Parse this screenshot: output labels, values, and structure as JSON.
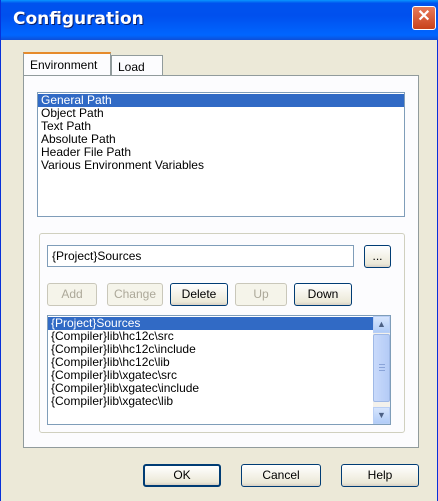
{
  "window": {
    "title": "Configuration",
    "close_glyph": "✕"
  },
  "tabs": [
    {
      "label": "Environment"
    },
    {
      "label": "Load"
    }
  ],
  "env_list": [
    "General Path",
    "Object Path",
    "Text Path",
    "Absolute Path",
    "Header File Path",
    "Various Environment Variables"
  ],
  "path_field": {
    "value": "{Project}Sources"
  },
  "browse_label": "...",
  "path_buttons": {
    "add": "Add",
    "change": "Change",
    "delete": "Delete",
    "up": "Up",
    "down": "Down"
  },
  "path_list": [
    "{Project}Sources",
    "{Compiler}lib\\hc12c\\src",
    "{Compiler}lib\\hc12c\\include",
    "{Compiler}lib\\hc12c\\lib",
    "{Compiler}lib\\xgatec\\src",
    "{Compiler}lib\\xgatec\\include",
    "{Compiler}lib\\xgatec\\lib"
  ],
  "scroll_glyphs": {
    "up": "▲",
    "down": "▼"
  },
  "dialog_buttons": {
    "ok": "OK",
    "cancel": "Cancel",
    "help": "Help"
  }
}
